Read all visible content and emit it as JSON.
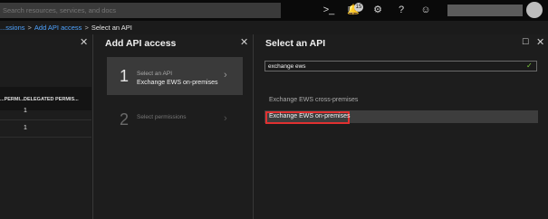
{
  "search": {
    "placeholder": "Search resources, services, and docs"
  },
  "topbar_icons": [
    "cloud-shell-icon",
    "directory-filter-icon",
    "notifications-icon",
    "settings-icon",
    "help-icon",
    "feedback-icon"
  ],
  "notifications": {
    "count": "15"
  },
  "breadcrumb": {
    "items": [
      "...ssions",
      "Add API access",
      "Select an API"
    ],
    "separator": ">"
  },
  "blade1": {
    "headers": [
      "...PERMI...",
      "DELEGATED PERMIS..."
    ],
    "rows": [
      {
        "delegated": "1"
      },
      {
        "delegated": "1"
      }
    ]
  },
  "blade2": {
    "title": "Add API access",
    "steps": [
      {
        "number": "1",
        "label": "Select an API",
        "value": "Exchange EWS on-premises"
      },
      {
        "number": "2",
        "label": "Select permissions"
      }
    ]
  },
  "blade3": {
    "title": "Select an API",
    "filter_value": "exchange ews",
    "results": [
      "Exchange EWS cross-premises",
      "Exchange EWS on-premises"
    ]
  },
  "colors": {
    "accent_link": "#4ea3ff",
    "highlight_border": "#e03131",
    "checkmark": "#7fd13b"
  }
}
